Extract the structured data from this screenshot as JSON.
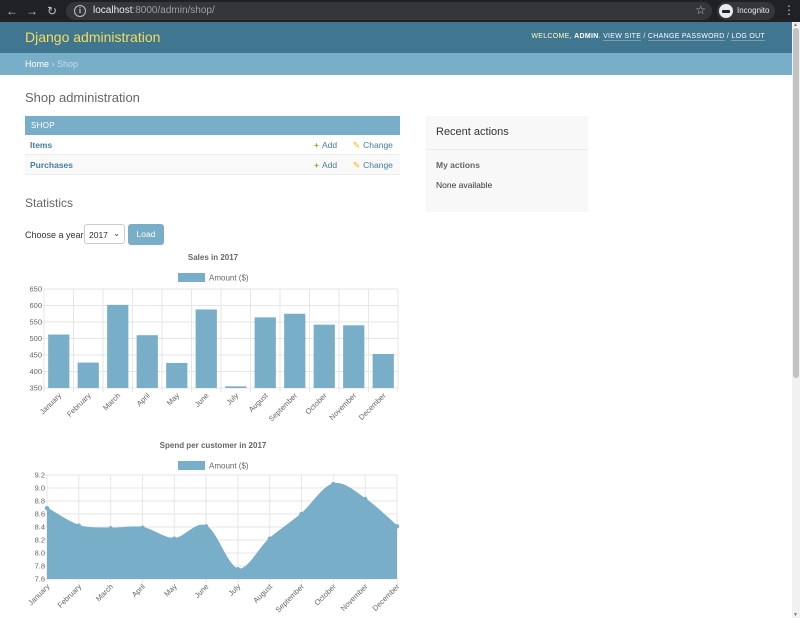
{
  "browser": {
    "url_host": "localhost",
    "url_path": ":8000/admin/shop/",
    "profile_label": "Incognito"
  },
  "header": {
    "branding": "Django administration",
    "welcome": "WELCOME,",
    "username": "ADMIN",
    "view_site": "VIEW SITE",
    "change_password": "CHANGE PASSWORD",
    "log_out": "LOG OUT",
    "separator": "/"
  },
  "breadcrumbs": {
    "home": "Home",
    "sep": "›",
    "current": "Shop"
  },
  "page_title": "Shop administration",
  "app_module": {
    "caption": "SHOP",
    "add_label": "Add",
    "change_label": "Change",
    "models": [
      {
        "name": "Items"
      },
      {
        "name": "Purchases"
      }
    ]
  },
  "recent_actions": {
    "title": "Recent actions",
    "my_actions": "My actions",
    "empty": "None available"
  },
  "statistics": {
    "title": "Statistics",
    "year_label": "Choose a year:",
    "year_value": "2017",
    "load_label": "Load"
  },
  "colors": {
    "header_bg": "#417690",
    "breadcrumb_bg": "#79aec8",
    "branding": "#f5dd5d",
    "chart_fill": "#79aec8"
  },
  "chart_data": [
    {
      "type": "bar",
      "title": "Sales in 2017",
      "categories": [
        "January",
        "February",
        "March",
        "April",
        "May",
        "June",
        "July",
        "August",
        "September",
        "October",
        "November",
        "December"
      ],
      "series": [
        {
          "name": "Amount ($)",
          "values": [
            512,
            427,
            602,
            510,
            426,
            588,
            355,
            564,
            575,
            542,
            540,
            453
          ]
        }
      ],
      "ylim": [
        350,
        650
      ],
      "yticks": [
        350,
        400,
        450,
        500,
        550,
        600,
        650
      ],
      "legend": "top",
      "grid": true
    },
    {
      "type": "area",
      "title": "Spend per customer in 2017",
      "categories": [
        "January",
        "February",
        "March",
        "April",
        "May",
        "June",
        "July",
        "August",
        "September",
        "October",
        "November",
        "December"
      ],
      "series": [
        {
          "name": "Amount ($)",
          "values": [
            8.69,
            8.42,
            8.38,
            8.39,
            8.22,
            8.41,
            7.75,
            8.22,
            8.6,
            9.06,
            8.83,
            8.41
          ]
        }
      ],
      "ylim": [
        7.6,
        9.2
      ],
      "yticks": [
        7.6,
        7.8,
        8.0,
        8.2,
        8.4,
        8.6,
        8.8,
        9.0,
        9.2
      ],
      "legend": "top",
      "grid": true
    }
  ]
}
